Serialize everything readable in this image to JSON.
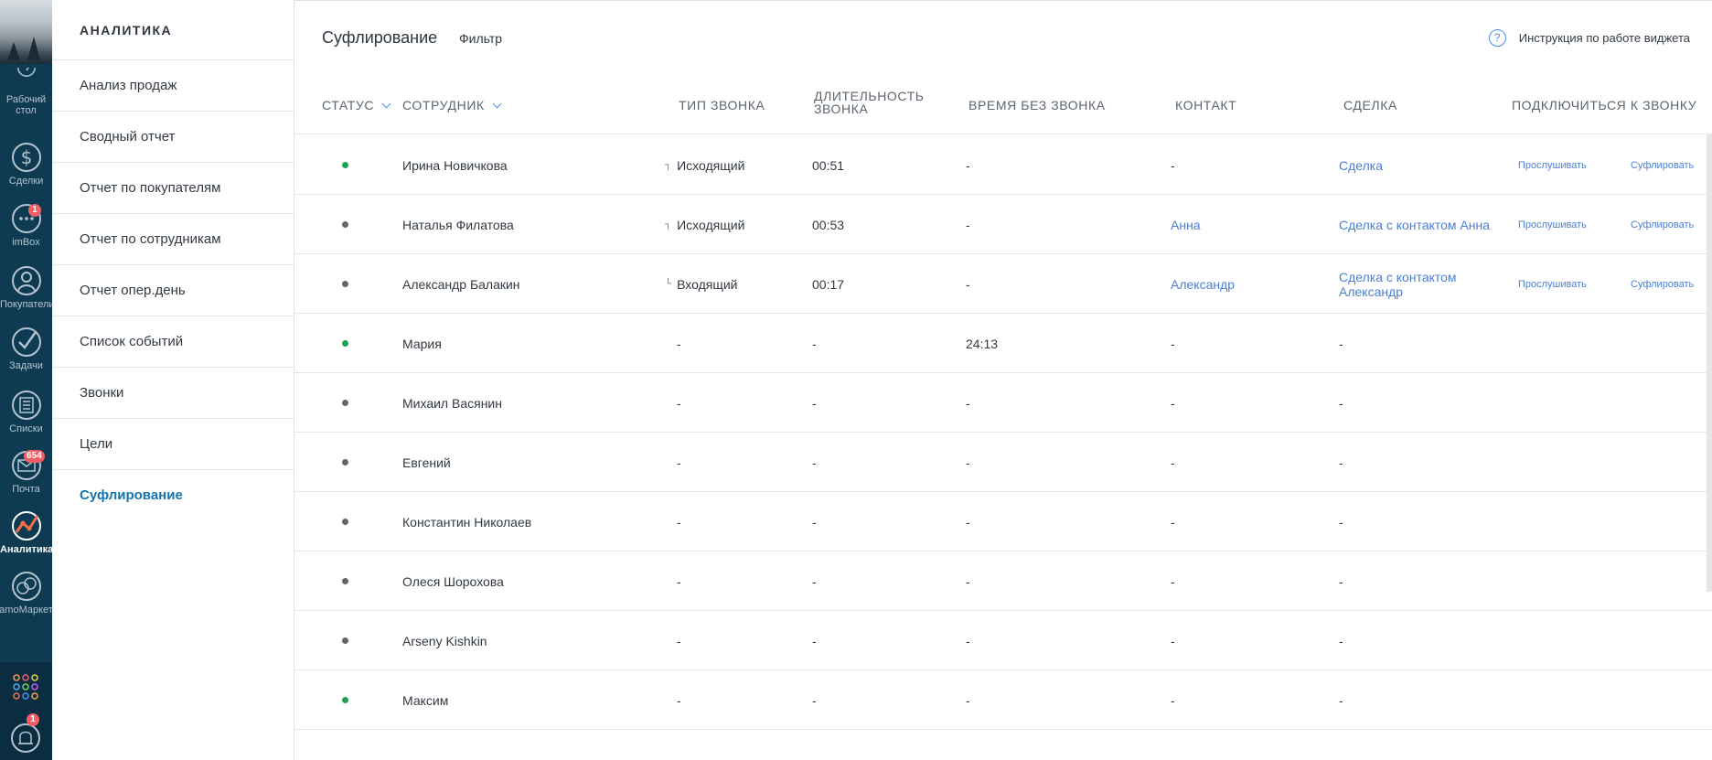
{
  "rail": {
    "items": [
      {
        "label": "Рабочий\nстол",
        "icon": "dashboard-icon"
      },
      {
        "label": "Сделки",
        "icon": "dollar-icon"
      },
      {
        "label": "imBox",
        "icon": "chat-icon",
        "badge": "1"
      },
      {
        "label": "Покупатели",
        "icon": "customers-icon"
      },
      {
        "label": "Задачи",
        "icon": "check-icon"
      },
      {
        "label": "Списки",
        "icon": "list-icon"
      },
      {
        "label": "Почта",
        "icon": "mail-icon",
        "badge": "654"
      },
      {
        "label": "Аналитика",
        "icon": "analytics-icon"
      },
      {
        "label": "amoМаркет",
        "icon": "market-icon"
      }
    ],
    "notification_badge": "1"
  },
  "submenu": {
    "title": "АНАЛИТИКА",
    "items": [
      "Анализ продаж",
      "Сводный отчет",
      "Отчет по покупателям",
      "Отчет по сотрудникам",
      "Отчет опер.день",
      "Список событий",
      "Звонки",
      "Цели",
      "Суфлирование"
    ]
  },
  "header": {
    "title": "Суфлирование",
    "filter": "Фильтр",
    "help": "Инструкция по работе виджета",
    "help_icon": "?"
  },
  "table": {
    "columns": {
      "status": "СТАТУС",
      "employee": "СОТРУДНИК",
      "call_type": "ТИП ЗВОНКА",
      "duration_1": "ДЛИТЕЛЬНОСТЬ",
      "duration_2": "ЗВОНКА",
      "idle": "ВРЕМЯ БЕЗ ЗВОНКА",
      "contact": "КОНТАКТ",
      "deal": "СДЕЛКА",
      "join": "ПОДКЛЮЧИТЬСЯ К ЗВОНКУ"
    },
    "listen_label": "Прослушивать",
    "prompt_label": "Суфлировать",
    "rows": [
      {
        "status": "green",
        "employee": "Ирина Новичкова",
        "call_type": "Исходящий",
        "call_icon": "outgoing-call-icon",
        "duration": "00:51",
        "idle": "-",
        "contact": "-",
        "contact_link": false,
        "deal": "Сделка",
        "deal_link": true,
        "actions": true
      },
      {
        "status": "grey",
        "employee": "Наталья Филатова",
        "call_type": "Исходящий",
        "call_icon": "outgoing-call-icon",
        "duration": "00:53",
        "idle": "-",
        "contact": "Анна",
        "contact_link": true,
        "deal": "Сделка с контактом Анна",
        "deal_link": true,
        "actions": true
      },
      {
        "status": "grey",
        "employee": "Александр Балакин",
        "call_type": "Входящий",
        "call_icon": "incoming-call-icon",
        "duration": "00:17",
        "idle": "-",
        "contact": "Александр",
        "contact_link": true,
        "deal": "Сделка с контактом Александр",
        "deal_link": true,
        "actions": true
      },
      {
        "status": "green",
        "employee": "Мария",
        "call_type": "-",
        "duration": "-",
        "idle": "24:13",
        "contact": "-",
        "contact_link": false,
        "deal": "-",
        "deal_link": false,
        "actions": false
      },
      {
        "status": "grey",
        "employee": "Михаил Васянин",
        "call_type": "-",
        "duration": "-",
        "idle": "-",
        "contact": "-",
        "contact_link": false,
        "deal": "-",
        "deal_link": false,
        "actions": false
      },
      {
        "status": "grey",
        "employee": "Евгений",
        "call_type": "-",
        "duration": "-",
        "idle": "-",
        "contact": "-",
        "contact_link": false,
        "deal": "-",
        "deal_link": false,
        "actions": false
      },
      {
        "status": "grey",
        "employee": "Константин Николаев",
        "call_type": "-",
        "duration": "-",
        "idle": "-",
        "contact": "-",
        "contact_link": false,
        "deal": "-",
        "deal_link": false,
        "actions": false
      },
      {
        "status": "grey",
        "employee": "Олеся Шорохова",
        "call_type": "-",
        "duration": "-",
        "idle": "-",
        "contact": "-",
        "contact_link": false,
        "deal": "-",
        "deal_link": false,
        "actions": false
      },
      {
        "status": "grey",
        "employee": "Arseny Kishkin",
        "call_type": "-",
        "duration": "-",
        "idle": "-",
        "contact": "-",
        "contact_link": false,
        "deal": "-",
        "deal_link": false,
        "actions": false
      },
      {
        "status": "green",
        "employee": "Максим",
        "call_type": "-",
        "duration": "-",
        "idle": "-",
        "contact": "-",
        "contact_link": false,
        "deal": "-",
        "deal_link": false,
        "actions": false
      }
    ]
  },
  "colors": {
    "rail_bg": "#0e3a52",
    "accent": "#1375ab",
    "link": "#4c7fd1",
    "status_online": "#1fa055",
    "status_offline": "#666666",
    "badge": "#f25e63"
  }
}
